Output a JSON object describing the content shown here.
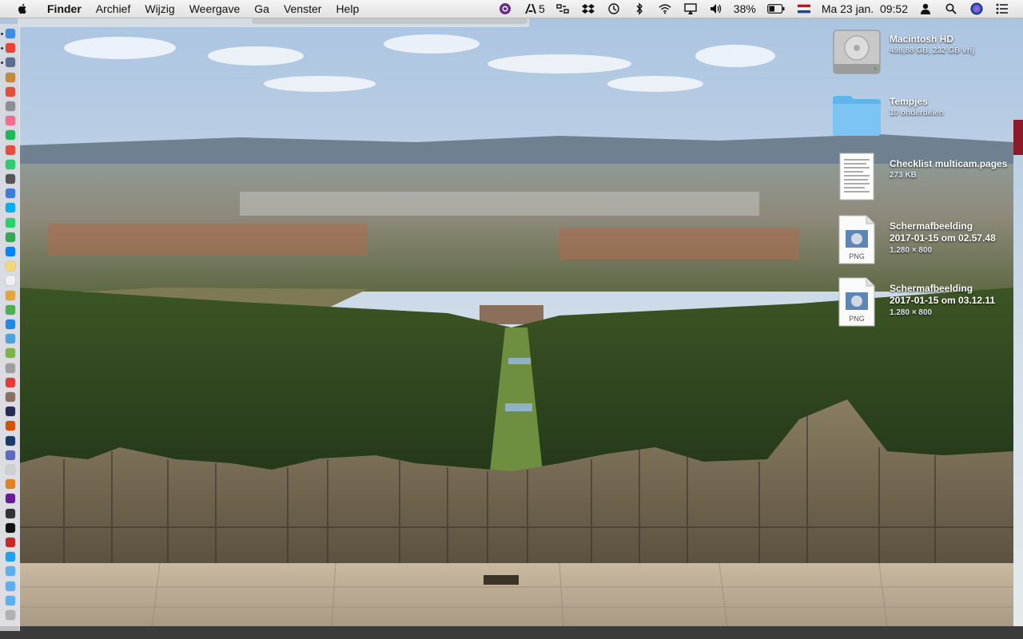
{
  "menubar": {
    "app_name": "Finder",
    "items": [
      "Archief",
      "Wijzig",
      "Weergave",
      "Ga",
      "Venster",
      "Help"
    ],
    "status": {
      "adobe_count": "5",
      "battery": "38%",
      "datetime": "Ma 23 jan.  09:52"
    },
    "icons": [
      "tor-icon",
      "adobe-icon",
      "screen-sharing-icon",
      "dropbox-icon",
      "time-machine-icon",
      "bluetooth-icon",
      "wifi-icon",
      "airplay-icon",
      "volume-icon",
      "battery-icon",
      "flag-nl-icon",
      "user-icon",
      "spotlight-icon",
      "siri-icon",
      "notification-center-icon"
    ]
  },
  "desktop": {
    "items": [
      {
        "name": "Macintosh HD",
        "sub": "498,88 GB, 232 GB vrij",
        "icon": "hard-drive-icon"
      },
      {
        "name": "Tempjes",
        "sub": "10 onderdelen",
        "icon": "folder-icon"
      },
      {
        "name": "Checklist multicam.pages",
        "sub": "273 KB",
        "icon": "pages-document-icon"
      },
      {
        "name": "Schermafbeelding",
        "name2": "2017-01-15 om 02.57.48",
        "sub": "1.280 × 800",
        "icon": "png-file-icon",
        "badge": "PNG"
      },
      {
        "name": "Schermafbeelding",
        "name2": "2017-01-15 om 03.12.11",
        "sub": "1.280 × 800",
        "icon": "png-file-icon",
        "badge": "PNG"
      }
    ]
  },
  "dock": {
    "colors": [
      "#3a8ee6",
      "#ea4335",
      "#5a6f8f",
      "#c58b3a",
      "#e44d3a",
      "#8e8e93",
      "#f26d8d",
      "#1db954",
      "#e74c3c",
      "#2ecc71",
      "#555555",
      "#3b7dd8",
      "#00aff0",
      "#25d366",
      "#34a853",
      "#0084ff",
      "#f7d774",
      "#f0f0f0",
      "#e8a33d",
      "#4caf50",
      "#1e88e5",
      "#4aa3df",
      "#7cb342",
      "#9e9e9e",
      "#e53935",
      "#8d6e63",
      "#2a2a5a",
      "#d35400",
      "#1a3a6b",
      "#5c6bc0",
      "#cfcfcf",
      "#e67e22",
      "#6a1b9a",
      "#333333",
      "#111111",
      "#c62828",
      "#1da1f2",
      "#5ab0f0",
      "#5ab0f0",
      "#5ab0f0",
      "#b0b0b0"
    ]
  }
}
